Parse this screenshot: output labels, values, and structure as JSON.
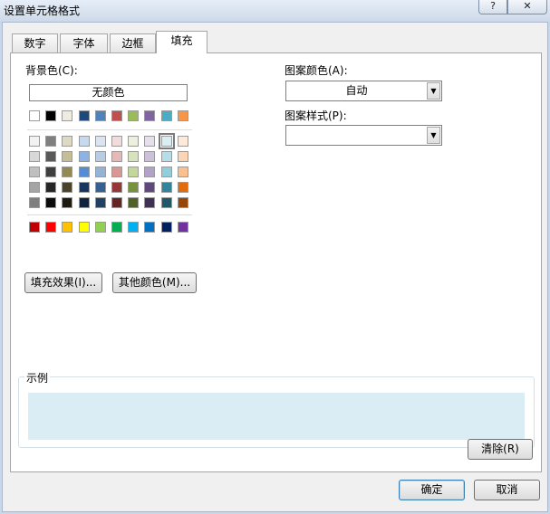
{
  "window": {
    "title": "设置单元格格式",
    "help_glyph": "?",
    "close_glyph": "✕"
  },
  "tabs": [
    {
      "label": "数字"
    },
    {
      "label": "字体"
    },
    {
      "label": "边框"
    },
    {
      "label": "填充"
    }
  ],
  "fill": {
    "background_label": "背景色(C):",
    "no_color": "无颜色",
    "row_top": [
      "#ffffff",
      "#000000",
      "#eeece1",
      "#1f497d",
      "#4f81bd",
      "#c0504d",
      "#9bbb59",
      "#8064a2",
      "#4bacc6",
      "#f79646"
    ],
    "theme_rows": [
      [
        "#f2f2f2",
        "#7f7f7f",
        "#ddd9c3",
        "#c6d9f0",
        "#dbe5f1",
        "#f2dcdb",
        "#ebf1dd",
        "#e5e0ec",
        "#dbeef3",
        "#fdeada"
      ],
      [
        "#d8d8d8",
        "#595959",
        "#c4bd97",
        "#8db3e2",
        "#b8cce4",
        "#e5b9b7",
        "#d7e3bc",
        "#ccc1d9",
        "#b7dde8",
        "#fbd5b5"
      ],
      [
        "#bfbfbf",
        "#3f3f3f",
        "#938953",
        "#548dd4",
        "#95b3d7",
        "#d99694",
        "#c3d69b",
        "#b2a2c7",
        "#92cddc",
        "#fac08f"
      ],
      [
        "#a5a5a5",
        "#262626",
        "#494429",
        "#17365d",
        "#366092",
        "#953734",
        "#76923c",
        "#5f497a",
        "#31859b",
        "#e36c09"
      ],
      [
        "#7f7f7f",
        "#0c0c0c",
        "#1d1b10",
        "#0f243e",
        "#244061",
        "#632423",
        "#4f6128",
        "#3f3151",
        "#205867",
        "#974806"
      ]
    ],
    "standard_row": [
      "#c00000",
      "#ff0000",
      "#ffc000",
      "#ffff00",
      "#92d050",
      "#00b050",
      "#00b0f0",
      "#0070c0",
      "#002060",
      "#7030a0"
    ],
    "selected_color": "#dbeef3",
    "fill_effects_button": "填充效果(I)...",
    "more_colors_button": "其他颜色(M)...",
    "pattern_color_label": "图案颜色(A):",
    "pattern_color_value": "自动",
    "pattern_style_label": "图案样式(P):",
    "pattern_style_value": "",
    "sample_label": "示例",
    "clear_button": "清除(R)"
  },
  "footer": {
    "ok_button": "确定",
    "cancel_button": "取消"
  }
}
